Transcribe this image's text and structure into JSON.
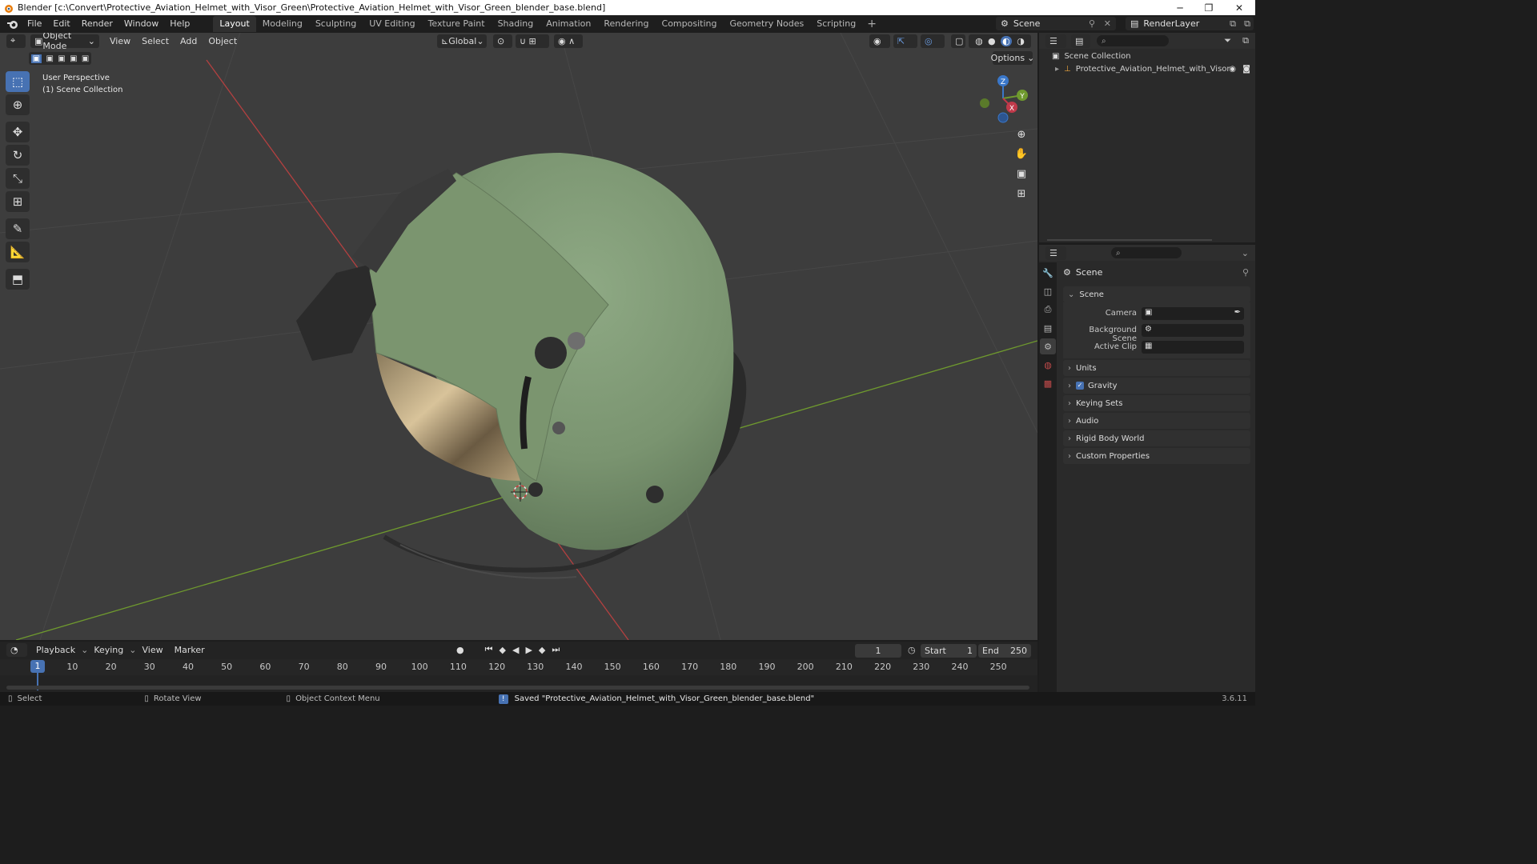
{
  "window": {
    "title": "Blender [c:\\Convert\\Protective_Aviation_Helmet_with_Visor_Green\\Protective_Aviation_Helmet_with_Visor_Green_blender_base.blend]",
    "minimize": "─",
    "maximize": "❐",
    "close": "✕"
  },
  "menubar": {
    "items": [
      "File",
      "Edit",
      "Render",
      "Window",
      "Help"
    ]
  },
  "workspaces": {
    "tabs": [
      "Layout",
      "Modeling",
      "Sculpting",
      "UV Editing",
      "Texture Paint",
      "Shading",
      "Animation",
      "Rendering",
      "Compositing",
      "Geometry Nodes",
      "Scripting"
    ],
    "add": "+"
  },
  "scene_selector": {
    "value": "Scene"
  },
  "viewlayer_selector": {
    "value": "RenderLayer"
  },
  "viewport": {
    "mode": "Object Mode",
    "menus": [
      "View",
      "Select",
      "Add",
      "Object"
    ],
    "transform_orientation": "Global",
    "options_label": "Options",
    "view_name": "User Perspective",
    "collection_label": "(1) Scene Collection"
  },
  "gizmo": {
    "x": "X",
    "y": "Y",
    "z": "Z"
  },
  "outliner": {
    "root": "Scene Collection",
    "object": "Protective_Aviation_Helmet_with_Visor"
  },
  "properties": {
    "context": "Scene",
    "section_title": "Scene",
    "camera_label": "Camera",
    "background_scene_label": "Background Scene",
    "active_clip_label": "Active Clip",
    "panels": [
      "Units",
      "Gravity",
      "Keying Sets",
      "Audio",
      "Rigid Body World",
      "Custom Properties"
    ],
    "gravity_checked": true
  },
  "timeline": {
    "menus": [
      "Playback",
      "Keying",
      "View",
      "Marker"
    ],
    "current_frame": "1",
    "start_label": "Start",
    "start_value": "1",
    "end_label": "End",
    "end_value": "250",
    "ticks": [
      "1",
      "10",
      "20",
      "30",
      "40",
      "50",
      "60",
      "70",
      "80",
      "90",
      "100",
      "110",
      "120",
      "130",
      "140",
      "150",
      "160",
      "170",
      "180",
      "190",
      "200",
      "210",
      "220",
      "230",
      "240",
      "250"
    ]
  },
  "statusbar": {
    "select": "Select",
    "rotate": "Rotate View",
    "context_menu": "Object Context Menu",
    "message": "Saved \"Protective_Aviation_Helmet_with_Visor_Green_blender_base.blend\"",
    "version": "3.6.11"
  },
  "colors": {
    "accent": "#4772b3",
    "helmet_green": "#7a9470",
    "viewport_bg": "#3d3d3d",
    "axis_x": "#b34040",
    "axis_y": "#6f9a2e"
  }
}
